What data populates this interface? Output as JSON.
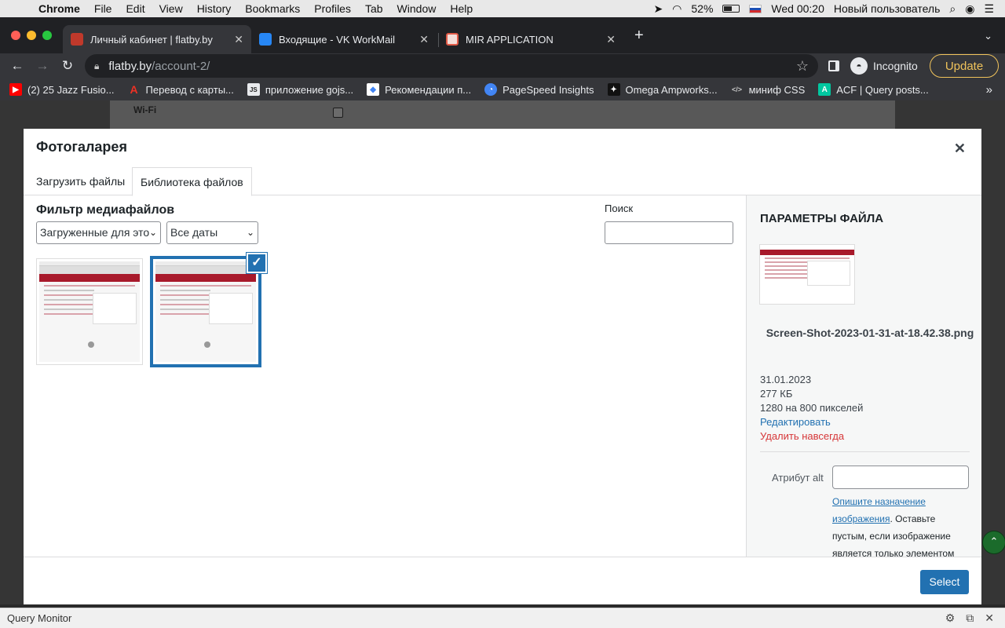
{
  "mac_menu": {
    "app": "Chrome",
    "items": [
      "File",
      "Edit",
      "View",
      "History",
      "Bookmarks",
      "Profiles",
      "Tab",
      "Window",
      "Help"
    ],
    "battery": "52%",
    "clock": "Wed 00:20",
    "user": "Новый пользователь"
  },
  "tabs": [
    {
      "title": "Личный кабинет | flatby.by",
      "icon": "flatby-icon",
      "color": "#c0392b",
      "active": true
    },
    {
      "title": "Входящие - VK WorkMail",
      "icon": "vk-workmail-icon",
      "color": "#2787f5",
      "active": false
    },
    {
      "title": "MIR APPLICATION",
      "icon": "mir-icon",
      "color": "#e05a47",
      "active": false
    }
  ],
  "omnibox": {
    "domain": "flatby.by",
    "path": "/account-2/"
  },
  "toolbar": {
    "incognito": "Incognito",
    "update": "Update"
  },
  "bookmarks": [
    {
      "label": "(2) 25 Jazz Fusio...",
      "icon": "youtube-icon",
      "glyph": "▶",
      "color": "#ff0000"
    },
    {
      "label": "Перевод с карты...",
      "icon": "alfa-icon",
      "glyph": "A",
      "color": "#ef3124"
    },
    {
      "label": "приложение gojs...",
      "icon": "gojs-icon",
      "glyph": "JS",
      "color": "#444444"
    },
    {
      "label": "Рекомендации п...",
      "icon": "google-icon",
      "glyph": "◆",
      "color": "#4285f4"
    },
    {
      "label": "PageSpeed Insights",
      "icon": "pagespeed-icon",
      "glyph": "◔",
      "color": "#4285f4"
    },
    {
      "label": "Omega Ampworks...",
      "icon": "omega-icon",
      "glyph": "✦",
      "color": "#222222"
    },
    {
      "label": "миниф CSS",
      "icon": "code-icon",
      "glyph": "</>",
      "color": "#35363a"
    },
    {
      "label": "ACF | Query posts...",
      "icon": "acf-icon",
      "glyph": "A",
      "color": "#00c7a0"
    }
  ],
  "page": {
    "wifi_label": "Wi-Fi"
  },
  "modal": {
    "title": "Фотогаларея",
    "tabs": {
      "upload": "Загрузить файлы",
      "library": "Библиотека файлов"
    },
    "filter_title": "Фильтр медиафайлов",
    "filter_type": "Загруженные для это",
    "filter_dates": "Все даты",
    "search_label": "Поиск",
    "search_value": "",
    "select_button": "Select"
  },
  "details": {
    "title": "ПАРАМЕТРЫ ФАЙЛА",
    "filename": "Screen-Shot-2023-01-31-at-18.42.38.png",
    "date": "31.01.2023",
    "size": "277 КБ",
    "dimensions": "1280 на 800 пикселей",
    "edit": "Редактировать",
    "delete": "Удалить навсегда",
    "alt_label": "Атрибут alt",
    "alt_value": "",
    "alt_help_link": "Опишите назначение изображения",
    "alt_help_text": ". Оставьте пустым, если изображение является только элементом"
  },
  "query_monitor": {
    "label": "Query Monitor"
  },
  "colors": {
    "accent": "#2271b1",
    "danger": "#d63638",
    "update": "#f0c35b"
  }
}
